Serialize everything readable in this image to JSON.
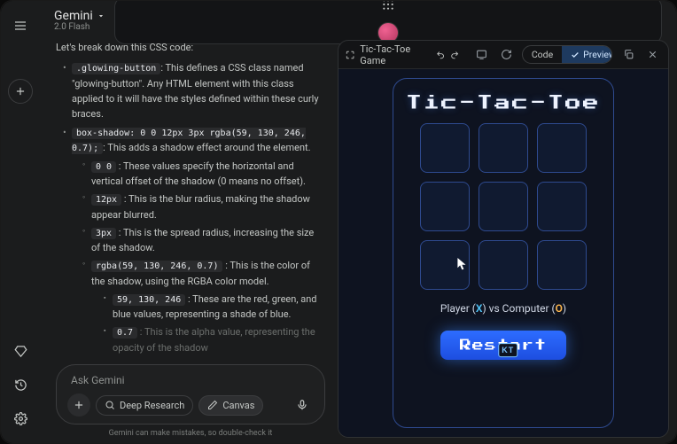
{
  "brand": {
    "name": "Gemini",
    "model": "2.0 Flash"
  },
  "content": {
    "intro": "Let's break down this CSS code:",
    "b1_code": ".glowing-button",
    "b1_text": ": This defines a CSS class named \"glowing-button\". Any HTML element with this class applied to it will have the styles defined within these curly braces.",
    "b2_code": "box-shadow: 0 0 12px 3px rgba(59, 130, 246, 0.7);",
    "b2_text": ": This adds a shadow effect around the element.",
    "s1_code": "0 0",
    "s1_text": " : These values specify the horizontal and vertical offset of the shadow (0 means no offset).",
    "s2_code": "12px",
    "s2_text": " : This is the blur radius, making the shadow appear blurred.",
    "s3_code": "3px",
    "s3_text": " : This is the spread radius, increasing the size of the shadow.",
    "s4_code": "rgba(59, 130, 246, 0.7)",
    "s4_text": " : This is the color of the shadow, using the RGBA color model.",
    "ss1_code": "59, 130, 246",
    "ss1_text": " : These are the red, green, and blue values, representing a shade of blue.",
    "ss2_code": "0.7",
    "ss2_text": " : This is the alpha value, representing the opacity of the shadow"
  },
  "input": {
    "placeholder": "Ask Gemini",
    "chips": {
      "deep_research": "Deep Research",
      "canvas": "Canvas"
    }
  },
  "disclaimer": "Gemini can make mistakes, so double-check it",
  "canvas": {
    "title": "Tic-Tac-Toe Game",
    "tabs": {
      "code": "Code",
      "preview": "Preview"
    }
  },
  "game": {
    "title": "Tic-Tac-Toe",
    "status_pre": "Player (",
    "status_x": "X",
    "status_mid": ") vs Computer (",
    "status_o": "O",
    "status_post": ")",
    "restart": "Restart",
    "kt": "KT"
  }
}
